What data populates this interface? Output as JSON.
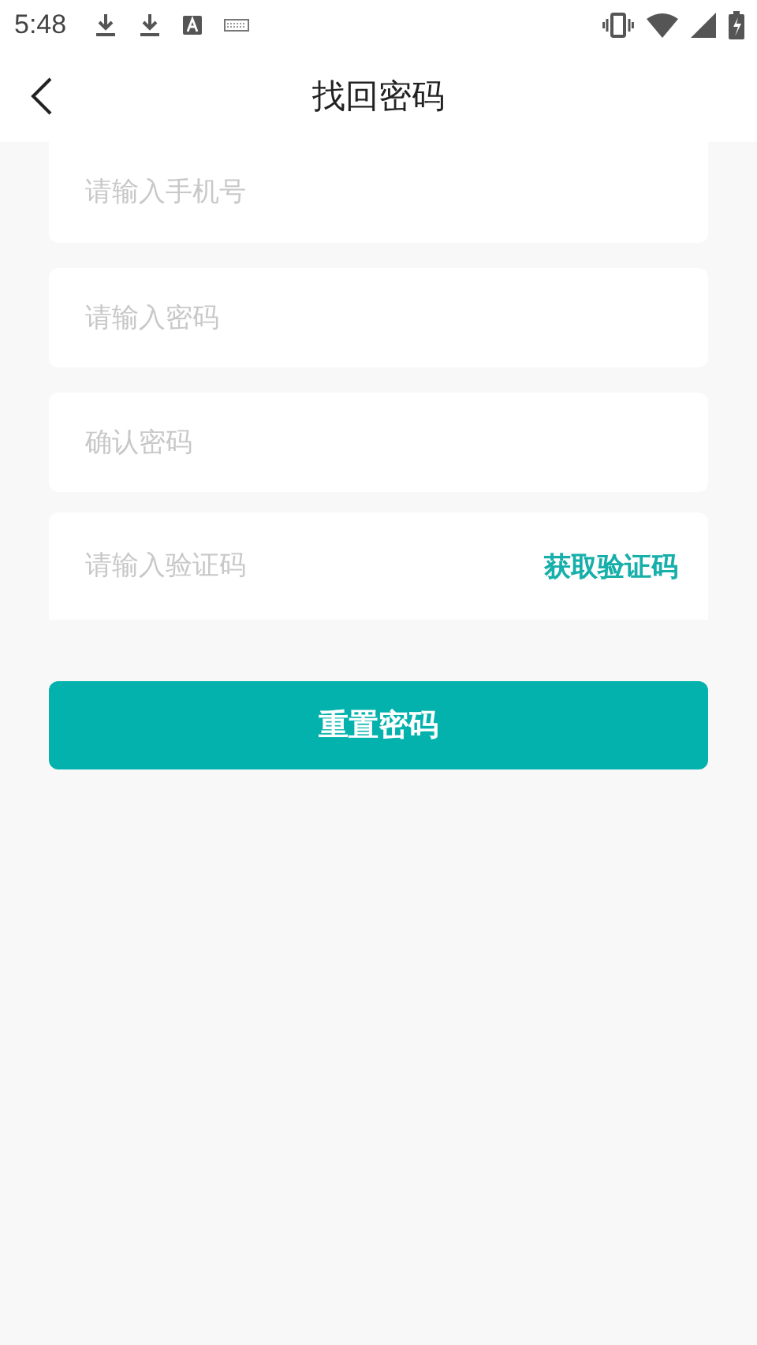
{
  "status_bar": {
    "time": "5:48"
  },
  "header": {
    "title": "找回密码"
  },
  "fields": [
    {
      "placeholder": "请输入手机号"
    },
    {
      "placeholder": "请输入密码"
    },
    {
      "placeholder": "确认密码"
    },
    {
      "placeholder": "请输入验证码",
      "action": "获取验证码"
    }
  ],
  "submit_button": "重置密码"
}
